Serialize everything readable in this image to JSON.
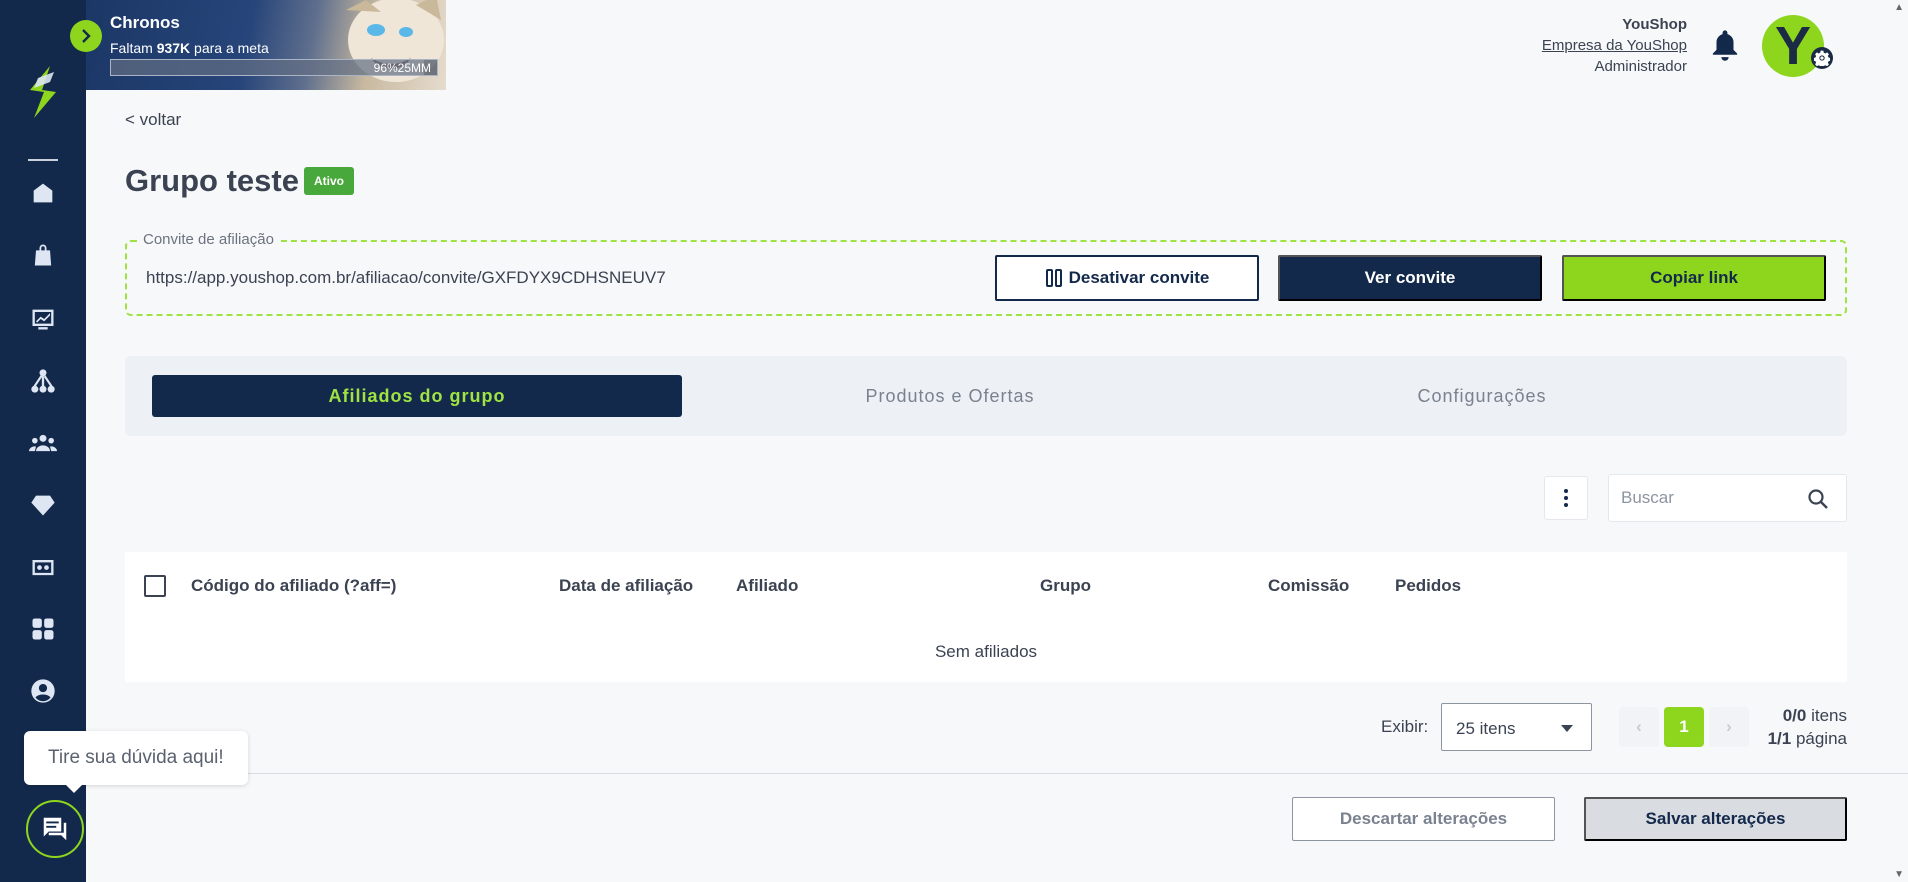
{
  "banner": {
    "name": "Chronos",
    "goal_prefix": "Faltam",
    "goal_amount": "937K",
    "goal_suffix": "para a meta",
    "progress_percent": 96,
    "progress_label": "96%25MM"
  },
  "user": {
    "company": "YouShop",
    "company_link": "Empresa da YouShop",
    "role": "Administrador",
    "avatar_letter": "Y"
  },
  "page": {
    "back_label": "< voltar",
    "title": "Grupo teste",
    "status_badge": "Ativo"
  },
  "invite": {
    "legend": "Convite de afiliação",
    "url": "https://app.youshop.com.br/afiliacao/convite/GXFDYX9CDHSNEUV7",
    "deactivate_label": "Desativar convite",
    "view_label": "Ver convite",
    "copy_label": "Copiar link"
  },
  "tabs": [
    {
      "label": "Afiliados do grupo",
      "active": true
    },
    {
      "label": "Produtos e Ofertas",
      "active": false
    },
    {
      "label": "Configurações",
      "active": false
    }
  ],
  "search": {
    "placeholder": "Buscar"
  },
  "table": {
    "columns": [
      "Código do afiliado (?aff=)",
      "Data de afiliação",
      "Afiliado",
      "Grupo",
      "Comissão",
      "Pedidos"
    ],
    "empty_message": "Sem afiliados"
  },
  "pagination": {
    "show_label": "Exibir:",
    "per_page": "25 itens",
    "current_page": "1",
    "items_count": "0/0",
    "items_label": "itens",
    "pages_count": "1/1",
    "pages_label": "página"
  },
  "footer": {
    "discard_label": "Descartar alterações",
    "save_label": "Salvar alterações"
  },
  "help": {
    "bubble_text": "Tire sua dúvida aqui!"
  },
  "colors": {
    "sidebar": "#13294b",
    "accent_green": "#8ed61e",
    "badge_green": "#49a83c"
  },
  "sidebar_icons": [
    "logo-icon",
    "store-icon",
    "shopping-bag-icon",
    "chart-icon",
    "network-icon",
    "users-icon",
    "diamond-icon",
    "dashboard-icon",
    "apps-icon",
    "account-icon"
  ]
}
